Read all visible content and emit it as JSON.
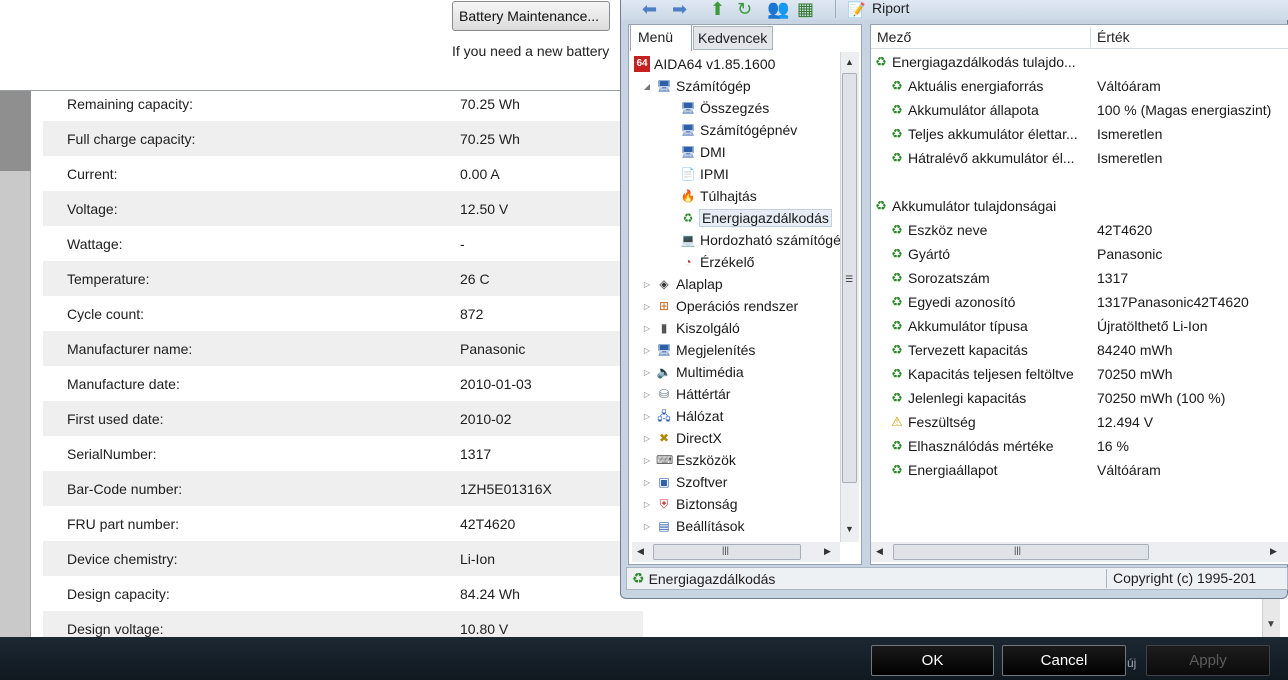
{
  "background_panel": {
    "battery_button_label": "Battery Maintenance...",
    "new_battery_text": "If you need a new battery",
    "rows": [
      {
        "label": "Remaining capacity:",
        "value": "70.25 Wh"
      },
      {
        "label": "Full charge capacity:",
        "value": "70.25 Wh"
      },
      {
        "label": "Current:",
        "value": "0.00 A"
      },
      {
        "label": "Voltage:",
        "value": "12.50 V"
      },
      {
        "label": "Wattage:",
        "value": "-"
      },
      {
        "label": "Temperature:",
        "value": "26 C"
      },
      {
        "label": "Cycle count:",
        "value": "872"
      },
      {
        "label": "Manufacturer name:",
        "value": "Panasonic"
      },
      {
        "label": "Manufacture date:",
        "value": "2010-01-03"
      },
      {
        "label": "First used date:",
        "value": "2010-02"
      },
      {
        "label": "SerialNumber:",
        "value": "1317"
      },
      {
        "label": "Bar-Code number:",
        "value": "1ZH5E01316X"
      },
      {
        "label": "FRU part number:",
        "value": "42T4620"
      },
      {
        "label": "Device chemistry:",
        "value": "Li-Ion"
      },
      {
        "label": "Design capacity:",
        "value": "84.24 Wh"
      },
      {
        "label": "Design voltage:",
        "value": "10.80 V"
      }
    ]
  },
  "dialog_buttons": {
    "ok": "OK",
    "cancel": "Cancel",
    "apply": "Apply",
    "tray_text": "új"
  },
  "aida": {
    "toolbar": {
      "report_label": "Riport"
    },
    "tabs": {
      "menu": "Menü",
      "favorites": "Kedvencek"
    },
    "tree": [
      {
        "label": "AIDA64 v1.85.1600",
        "icon": "aida64-icon",
        "glyph": "64",
        "level": 0,
        "expander": ""
      },
      {
        "label": "Számítógép",
        "icon": "computer-icon",
        "glyph": "🖥",
        "level": 1,
        "expander": "◢"
      },
      {
        "label": "Összegzés",
        "icon": "summary-icon",
        "glyph": "🖥",
        "level": 2,
        "expander": ""
      },
      {
        "label": "Számítógépnév",
        "icon": "computer-name-icon",
        "glyph": "🖥",
        "level": 2,
        "expander": ""
      },
      {
        "label": "DMI",
        "icon": "dmi-icon",
        "glyph": "🖥",
        "level": 2,
        "expander": ""
      },
      {
        "label": "IPMI",
        "icon": "ipmi-icon",
        "glyph": "📄",
        "level": 2,
        "expander": ""
      },
      {
        "label": "Túlhajtás",
        "icon": "overclock-icon",
        "glyph": "🔥",
        "level": 2,
        "expander": ""
      },
      {
        "label": "Energiagazdálkodás",
        "icon": "power-management-icon",
        "glyph": "♻",
        "level": 2,
        "expander": "",
        "selected": true
      },
      {
        "label": "Hordozható számítógép",
        "icon": "laptop-icon",
        "glyph": "💻",
        "level": 2,
        "expander": ""
      },
      {
        "label": "Érzékelő",
        "icon": "sensor-icon",
        "glyph": "◔",
        "level": 2,
        "expander": ""
      },
      {
        "label": "Alaplap",
        "icon": "motherboard-icon",
        "glyph": "◈",
        "level": 1,
        "expander": "▷"
      },
      {
        "label": "Operációs rendszer",
        "icon": "windows-icon",
        "glyph": "⊞",
        "level": 1,
        "expander": "▷"
      },
      {
        "label": "Kiszolgáló",
        "icon": "server-icon",
        "glyph": "▮",
        "level": 1,
        "expander": "▷"
      },
      {
        "label": "Megjelenítés",
        "icon": "display-icon",
        "glyph": "🖥",
        "level": 1,
        "expander": "▷"
      },
      {
        "label": "Multimédia",
        "icon": "multimedia-icon",
        "glyph": "🔈",
        "level": 1,
        "expander": "▷"
      },
      {
        "label": "Háttértár",
        "icon": "storage-icon",
        "glyph": "⛁",
        "level": 1,
        "expander": "▷"
      },
      {
        "label": "Hálózat",
        "icon": "network-icon",
        "glyph": "🖧",
        "level": 1,
        "expander": "▷"
      },
      {
        "label": "DirectX",
        "icon": "directx-icon",
        "glyph": "✖",
        "level": 1,
        "expander": "▷"
      },
      {
        "label": "Eszközök",
        "icon": "devices-icon",
        "glyph": "⌨",
        "level": 1,
        "expander": "▷"
      },
      {
        "label": "Szoftver",
        "icon": "software-icon",
        "glyph": "▣",
        "level": 1,
        "expander": "▷"
      },
      {
        "label": "Biztonság",
        "icon": "security-shield-icon",
        "glyph": "⛨",
        "level": 1,
        "expander": "▷"
      },
      {
        "label": "Beállítások",
        "icon": "settings-icon",
        "glyph": "▤",
        "level": 1,
        "expander": "▷"
      }
    ],
    "report": {
      "col_field": "Mező",
      "col_value": "Érték",
      "rows": [
        {
          "type": "group",
          "field": "Energiagazdálkodás tulajdo...",
          "value": "",
          "icon": "power-management-icon",
          "glyph": "♻"
        },
        {
          "type": "item",
          "field": "Aktuális energiaforrás",
          "value": "Váltóáram",
          "icon": "power-management-icon",
          "glyph": "♻"
        },
        {
          "type": "item",
          "field": "Akkumulátor állapota",
          "value": "100 % (Magas energiaszint)",
          "icon": "power-management-icon",
          "glyph": "♻"
        },
        {
          "type": "item",
          "field": "Teljes akkumulátor élettar...",
          "value": "Ismeretlen",
          "icon": "power-management-icon",
          "glyph": "♻"
        },
        {
          "type": "item",
          "field": "Hátralévő akkumulátor él...",
          "value": "Ismeretlen",
          "icon": "power-management-icon",
          "glyph": "♻"
        },
        {
          "type": "spacer",
          "field": "",
          "value": "",
          "icon": "",
          "glyph": ""
        },
        {
          "type": "group",
          "field": "Akkumulátor tulajdonságai",
          "value": "",
          "icon": "power-management-icon",
          "glyph": "♻"
        },
        {
          "type": "item",
          "field": "Eszköz neve",
          "value": "42T4620",
          "icon": "power-management-icon",
          "glyph": "♻"
        },
        {
          "type": "item",
          "field": "Gyártó",
          "value": "Panasonic",
          "icon": "power-management-icon",
          "glyph": "♻"
        },
        {
          "type": "item",
          "field": "Sorozatszám",
          "value": "1317",
          "icon": "power-management-icon",
          "glyph": "♻"
        },
        {
          "type": "item",
          "field": "Egyedi azonosító",
          "value": "1317Panasonic42T4620",
          "icon": "power-management-icon",
          "glyph": "♻"
        },
        {
          "type": "item",
          "field": "Akkumulátor típusa",
          "value": "Újratölthető Li-Ion",
          "icon": "power-management-icon",
          "glyph": "♻"
        },
        {
          "type": "item",
          "field": "Tervezett kapacitás",
          "value": "84240 mWh",
          "icon": "power-management-icon",
          "glyph": "♻"
        },
        {
          "type": "item",
          "field": "Kapacitás teljesen feltöltve",
          "value": "70250 mWh",
          "icon": "power-management-icon",
          "glyph": "♻"
        },
        {
          "type": "item",
          "field": "Jelenlegi kapacitás",
          "value": "70250 mWh  (100 %)",
          "icon": "power-management-icon",
          "glyph": "♻"
        },
        {
          "type": "item",
          "field": "Feszültség",
          "value": "12.494 V",
          "icon": "warning-icon",
          "glyph": "⚠"
        },
        {
          "type": "item",
          "field": "Elhasználódás mértéke",
          "value": "16 %",
          "icon": "power-management-icon",
          "glyph": "♻"
        },
        {
          "type": "item",
          "field": "Energiaállapot",
          "value": "Váltóáram",
          "icon": "power-management-icon",
          "glyph": "♻"
        }
      ]
    },
    "status": {
      "left": "Energiagazdálkodás",
      "right": "Copyright (c) 1995-201"
    }
  }
}
